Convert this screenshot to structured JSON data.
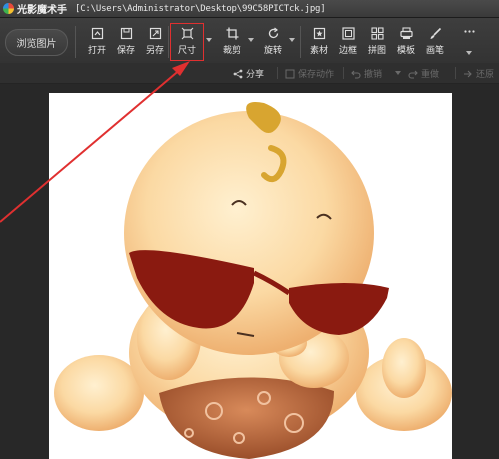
{
  "title_bar": {
    "app_name": "光影魔术手",
    "file_path": "[C:\\Users\\Administrator\\Desktop\\99C58PICTck.jpg]"
  },
  "toolbar": {
    "browse_label": "浏览图片",
    "tools": [
      {
        "label": "打开",
        "icon": "open-icon"
      },
      {
        "label": "保存",
        "icon": "save-icon"
      },
      {
        "label": "另存",
        "icon": "save-as-icon"
      },
      {
        "label": "尺寸",
        "icon": "resize-icon",
        "highlighted": true
      },
      {
        "label": "裁剪",
        "icon": "crop-icon"
      },
      {
        "label": "旋转",
        "icon": "rotate-icon"
      },
      {
        "label": "素材",
        "icon": "material-icon"
      },
      {
        "label": "边框",
        "icon": "border-icon"
      },
      {
        "label": "拼图",
        "icon": "collage-icon"
      },
      {
        "label": "模板",
        "icon": "template-icon"
      },
      {
        "label": "画笔",
        "icon": "brush-icon"
      }
    ],
    "more_icon": "more-icon",
    "highlight_color": "#e03030"
  },
  "subbar": {
    "share": "分享",
    "save_action": "保存动作",
    "undo": "撤销",
    "redo": "重做",
    "forward": "还原"
  },
  "colors": {
    "background": "#2b2b2b",
    "annotation_arrow": "#e03030"
  }
}
